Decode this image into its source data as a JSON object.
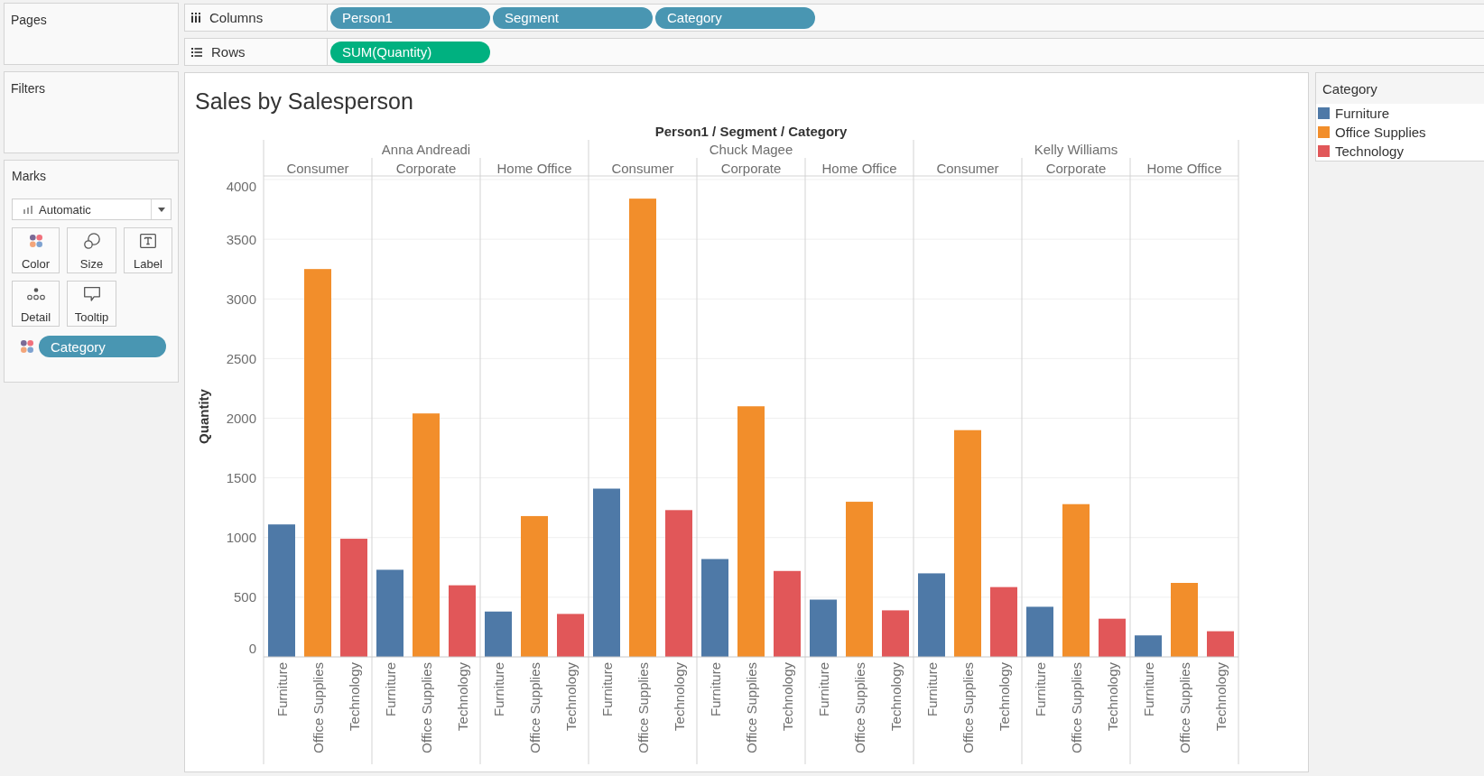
{
  "left_panel": {
    "pages": {
      "title": "Pages"
    },
    "filters": {
      "title": "Filters"
    },
    "marks": {
      "title": "Marks",
      "mark_type": "Automatic",
      "cards": [
        {
          "label": "Color"
        },
        {
          "label": "Size"
        },
        {
          "label": "Label"
        },
        {
          "label": "Detail"
        },
        {
          "label": "Tooltip"
        }
      ],
      "fields": [
        {
          "label": "Category",
          "kind": "dimension"
        }
      ]
    }
  },
  "shelves": [
    {
      "label": "Columns",
      "pills": [
        {
          "label": "Person1",
          "kind": "dimension"
        },
        {
          "label": "Segment",
          "kind": "dimension"
        },
        {
          "label": "Category",
          "kind": "dimension"
        }
      ]
    },
    {
      "label": "Rows",
      "pills": [
        {
          "label": "SUM(Quantity)",
          "kind": "measure"
        }
      ]
    }
  ],
  "sheet": {
    "column_groups": [
      {
        "label": "Anna Andreadi",
        "segments": [
          {
            "label": "Consumer"
          },
          {
            "label": "Corporate"
          },
          {
            "label": "Home Office"
          }
        ]
      },
      {
        "label": "Chuck Magee",
        "segments": [
          {
            "label": "Consumer"
          },
          {
            "label": "Corporate"
          },
          {
            "label": "Home Office"
          }
        ]
      },
      {
        "label": "Kelly Williams",
        "segments": [
          {
            "label": "Consumer"
          },
          {
            "label": "Corporate"
          },
          {
            "label": "Home Office"
          }
        ]
      }
    ],
    "chart_data": {
      "type": "bar",
      "title": "Sales by Salesperson",
      "xlabel": "Person1 / Segment / Category",
      "ylabel": "Quantity",
      "categories": [
        "Furniture",
        "Office Supplies",
        "Technology",
        "Furniture",
        "Office Supplies",
        "Technology",
        "Furniture",
        "Office Supplies",
        "Technology",
        "Furniture",
        "Office Supplies",
        "Technology",
        "Furniture",
        "Office Supplies",
        "Technology",
        "Furniture",
        "Office Supplies",
        "Technology",
        "Furniture",
        "Office Supplies",
        "Technology",
        "Furniture",
        "Office Supplies",
        "Technology",
        "Furniture",
        "Office Supplies",
        "Technology"
      ],
      "values": [
        1110,
        3250,
        990,
        730,
        2040,
        600,
        380,
        1180,
        360,
        1410,
        3840,
        1230,
        820,
        2100,
        720,
        480,
        1300,
        390,
        700,
        1900,
        585,
        420,
        1280,
        320,
        180,
        620,
        215
      ],
      "colors": [
        "#4e79a7",
        "#f28e2b",
        "#e15759",
        "#4e79a7",
        "#f28e2b",
        "#e15759",
        "#4e79a7",
        "#f28e2b",
        "#e15759",
        "#4e79a7",
        "#f28e2b",
        "#e15759",
        "#4e79a7",
        "#f28e2b",
        "#e15759",
        "#4e79a7",
        "#f28e2b",
        "#e15759",
        "#4e79a7",
        "#f28e2b",
        "#e15759",
        "#4e79a7",
        "#f28e2b",
        "#e15759",
        "#4e79a7",
        "#f28e2b",
        "#e15759"
      ],
      "yticks": [
        0,
        500,
        1000,
        1500,
        2000,
        2500,
        3000,
        3500,
        4000
      ],
      "ylim": [
        0,
        4030
      ],
      "grid": true
    }
  },
  "legend": {
    "title": "Category",
    "items": [
      {
        "label": "Furniture",
        "color": "#4e79a7"
      },
      {
        "label": "Office Supplies",
        "color": "#f28e2b"
      },
      {
        "label": "Technology",
        "color": "#e15759"
      }
    ]
  }
}
